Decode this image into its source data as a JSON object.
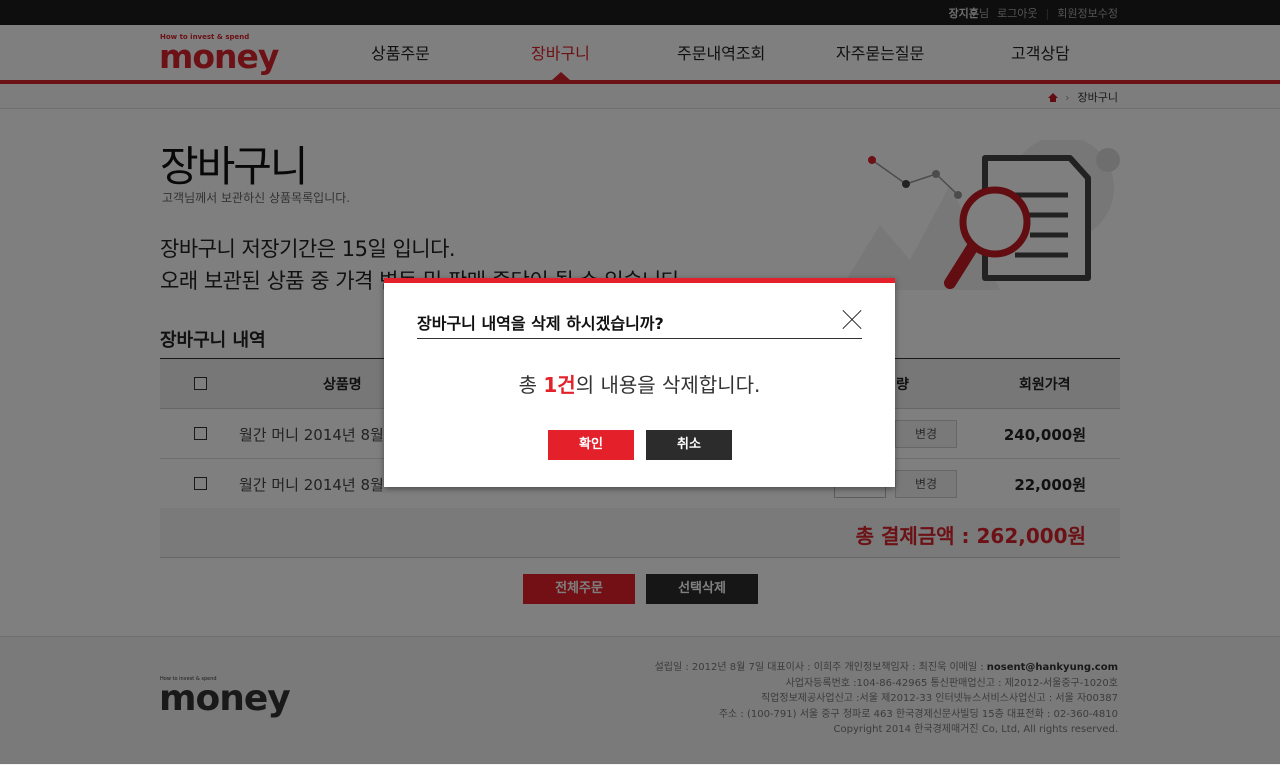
{
  "util": {
    "user_name": "장지훈",
    "user_suffix": "님",
    "logout": "로그아웃",
    "sep": "|",
    "edit_info": "회원정보수정"
  },
  "logo": {
    "tagline": "How to invest & spend",
    "name": "money"
  },
  "nav": [
    {
      "label": "상품주문"
    },
    {
      "label": "장바구니"
    },
    {
      "label": "주문내역조회"
    },
    {
      "label": "자주묻는질문"
    },
    {
      "label": "고객상담"
    }
  ],
  "breadcrumb": {
    "sep": "›",
    "current": "장바구니"
  },
  "page": {
    "title": "장바구니",
    "subtitle": "고객님께서 보관하신 상품목록입니다.",
    "notice_line1": "장바구니 저장기간은 15일 입니다.",
    "notice_line2": "오래 보관된 상품 중 가격 변동 및 판매 중단이 될 수 있습니다."
  },
  "cart": {
    "section_title": "장바구니 내역",
    "headers": {
      "name": "상품명",
      "qty": "량",
      "price": "회원가격"
    },
    "rows": [
      {
        "name": "월간 머니 2014년 8월",
        "change": "변경",
        "price": "240,000원"
      },
      {
        "name": "월간 머니 2014년 8월",
        "change": "변경",
        "price": "22,000원"
      }
    ],
    "total": "총 결제금액 : 262,000원",
    "order_all": "전체주문",
    "delete_selected": "선택삭제"
  },
  "footer": {
    "logo_tagline": "How to invest & spend",
    "logo_name": "money",
    "line1_pre": "설립일 : 2012년 8월 7일 대표이사 : 이희주 개인정보책임자 : 최진욱 이메일 : ",
    "email": "nosent@hankyung.com",
    "line2": "사업자등록번호 :104-86-42965 통신판매업신고 : 제2012-서울중구-1020호",
    "line3": "직업정보제공사업신고 :서울 제2012-33 인터넷뉴스서비스사업신고 : 서울 자00387",
    "line4": "주소 : (100-791) 서울 중구 청파로 463 한국경제신문사빌딩 15층 대표전화 : 02-360-4810",
    "line5": "Copyright 2014 한국경제매거진 Co, Ltd, All rights reserved."
  },
  "modal": {
    "title": "장바구니 내역을 삭제 하시겠습니까?",
    "msg_pre": "총 ",
    "msg_count": "1건",
    "msg_post": "의 내용을 삭제합니다.",
    "confirm": "확인",
    "cancel": "취소"
  },
  "colors": {
    "accent": "#e4202a",
    "dark_button": "#2c2c2c"
  }
}
